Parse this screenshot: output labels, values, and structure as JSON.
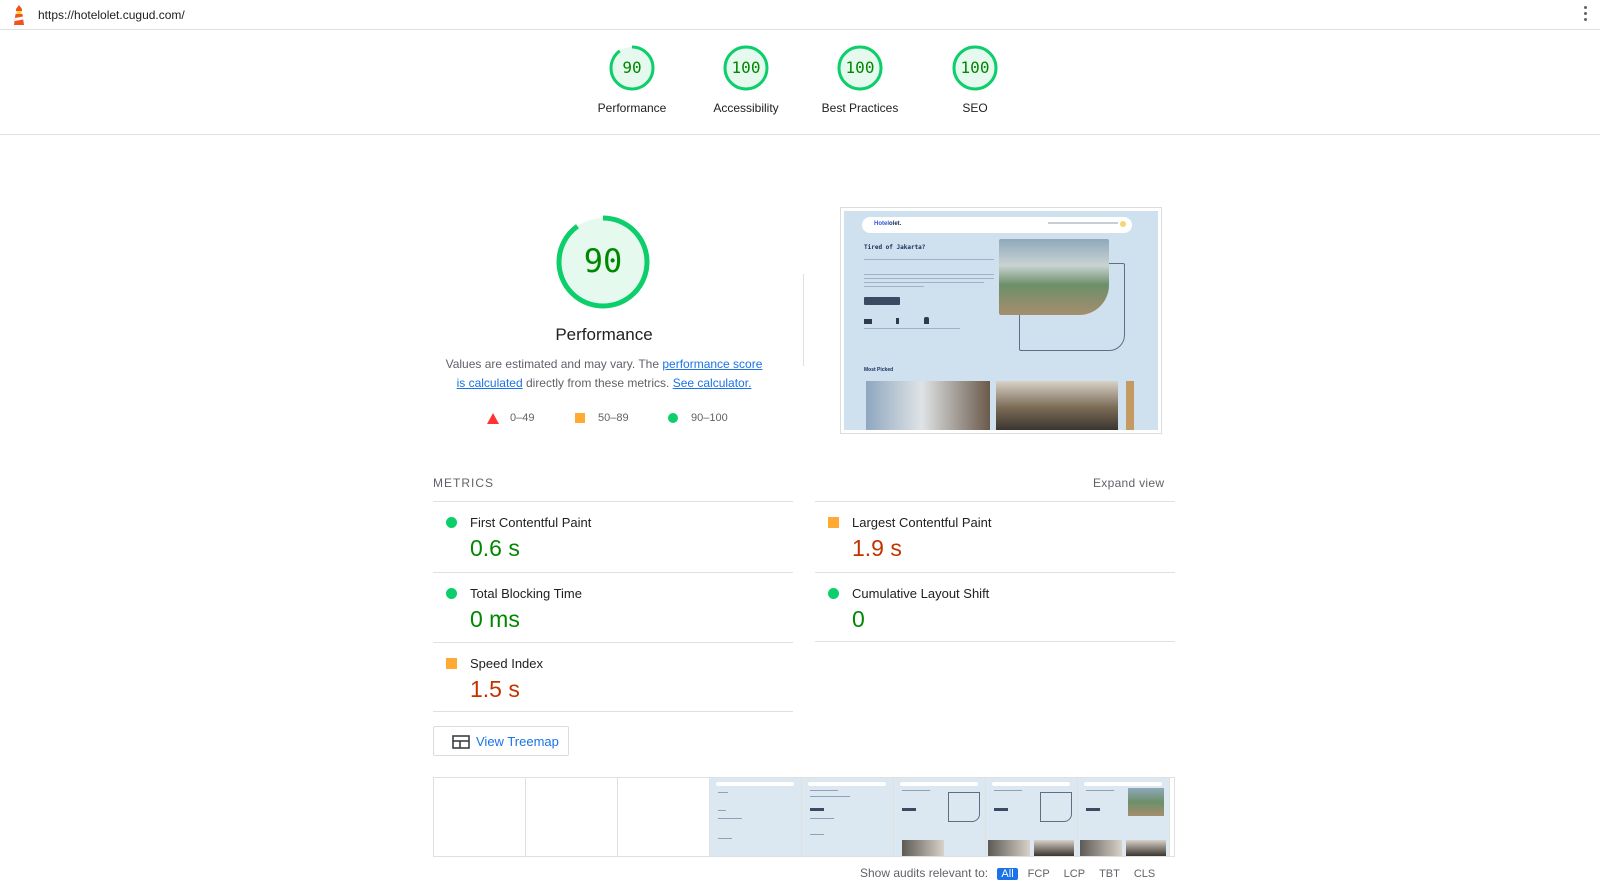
{
  "topbar": {
    "url": "https://hotelolet.cugud.com/",
    "logo_icon": "lighthouse-icon",
    "menu_icon": "more-vert-icon"
  },
  "colors": {
    "pass": "#0cce6b",
    "pass_text": "#008800",
    "average": "#ffaa33",
    "average_text": "#c33300",
    "fail": "#ff3333",
    "link": "#1a73e8"
  },
  "summary": [
    {
      "score": "90",
      "label": "Performance",
      "fraction": 0.9
    },
    {
      "score": "100",
      "label": "Accessibility",
      "fraction": 1.0
    },
    {
      "score": "100",
      "label": "Best Practices",
      "fraction": 1.0
    },
    {
      "score": "100",
      "label": "SEO",
      "fraction": 1.0
    }
  ],
  "performance": {
    "score": "90",
    "fraction": 0.9,
    "title": "Performance",
    "desc_prefix": "Values are estimated and may vary. The ",
    "desc_link1": "performance score is calculated",
    "desc_middle": " directly from these metrics. ",
    "desc_link2": "See calculator.",
    "legend": {
      "fail": "0–49",
      "average": "50–89",
      "pass": "90–100"
    }
  },
  "screenshot": {
    "brand_a": "Hotel",
    "brand_b": "olet.",
    "heading": "Tired of Jakarta?",
    "section": "Most Picked"
  },
  "metrics": {
    "header": "METRICS",
    "expand": "Expand view",
    "items": {
      "fcp": {
        "name": "First Contentful Paint",
        "value": "0.6 s",
        "rating": "pass"
      },
      "lcp": {
        "name": "Largest Contentful Paint",
        "value": "1.9 s",
        "rating": "average"
      },
      "tbt": {
        "name": "Total Blocking Time",
        "value": "0 ms",
        "rating": "pass"
      },
      "cls": {
        "name": "Cumulative Layout Shift",
        "value": "0",
        "rating": "pass"
      },
      "si": {
        "name": "Speed Index",
        "value": "1.5 s",
        "rating": "average"
      }
    }
  },
  "treemap": {
    "label": "View Treemap",
    "icon": "treemap-icon"
  },
  "filter": {
    "label": "Show audits relevant to:",
    "chips": [
      "All",
      "FCP",
      "LCP",
      "TBT",
      "CLS"
    ]
  }
}
